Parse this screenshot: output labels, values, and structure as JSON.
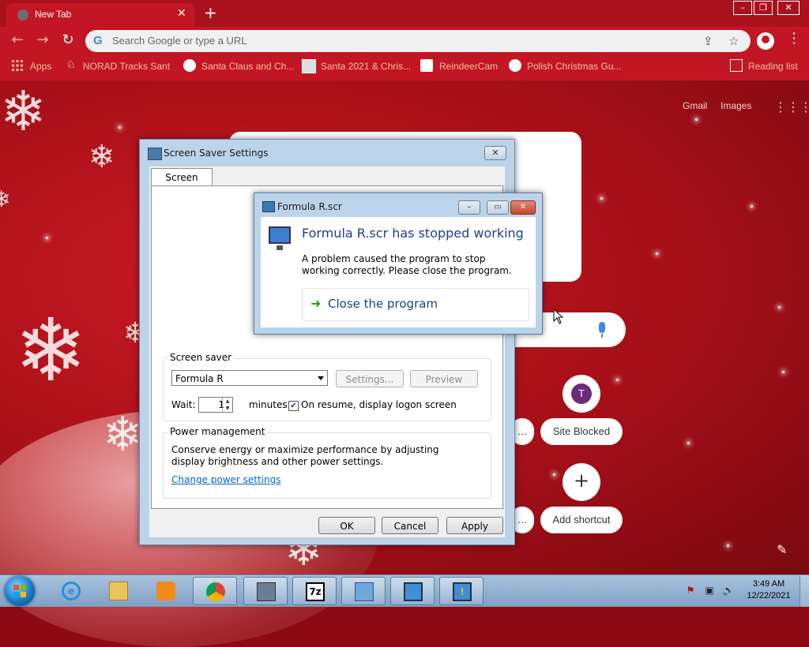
{
  "browser": {
    "tab_title": "New Tab",
    "omnibox_placeholder": "Search Google or type a URL",
    "bookmarks": [
      {
        "label": "Apps"
      },
      {
        "label": "NORAD Tracks Santa"
      },
      {
        "label": "Santa Claus and Ch..."
      },
      {
        "label": "Santa 2021 & Chris..."
      },
      {
        "label": "ReindeerCam"
      },
      {
        "label": "Polish Christmas Gu..."
      },
      {
        "label": "Reading list"
      }
    ]
  },
  "ntp": {
    "gmail": "Gmail",
    "images": "Images",
    "shortcuts": [
      {
        "label": "Site Blocked",
        "initial": "T"
      },
      {
        "label": "Add shortcut",
        "initial": "+"
      }
    ]
  },
  "screen_saver_dialog": {
    "title": "Screen Saver Settings",
    "close": "✕",
    "tab": "Screen Saver",
    "screen_saver_group": "Screen saver",
    "selected": "Formula R",
    "settings_btn": "Settings...",
    "preview_btn": "Preview",
    "wait_label": "Wait:",
    "wait_value": "1",
    "minutes_label": "minutes",
    "logon_label": "On resume, display logon screen",
    "logon_checked": true,
    "power_group": "Power management",
    "power_text": "Conserve energy or maximize performance by adjusting display brightness and other power settings.",
    "power_link": "Change power settings",
    "ok": "OK",
    "cancel": "Cancel",
    "apply": "Apply"
  },
  "error_dialog": {
    "title": "Formula R.scr",
    "heading": "Formula R.scr has stopped working",
    "message": "A problem caused the program to stop working correctly. Please close the program.",
    "action": "Close the program"
  },
  "taskbar": {
    "time": "3:49 AM",
    "date": "12/22/2021"
  },
  "colors": {
    "chrome_red": "#c31624",
    "taskbar": "#a9c3de",
    "link": "#0066cc"
  }
}
